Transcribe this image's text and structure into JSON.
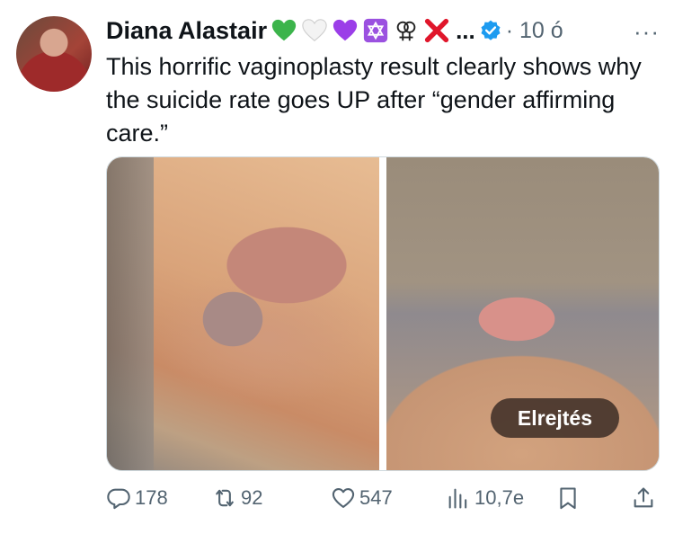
{
  "author": {
    "name": "Diana Alastair",
    "emoji_icons": [
      "green-heart-icon",
      "white-heart-icon",
      "purple-heart-icon",
      "star-of-david-icon",
      "lesbian-symbol-icon",
      "red-x-icon"
    ],
    "ellipsis": "...",
    "verified_color": "#1d9bf0",
    "time": "· 10 ó"
  },
  "more_label": "···",
  "tweet": {
    "text": "This horrific vaginoplasty result clearly shows why the suicide rate goes UP after “gender affirming care.”"
  },
  "media": {
    "hide_button_label": "Elrejtés"
  },
  "actions": {
    "reply_count": "178",
    "retweet_count": "92",
    "like_count": "547",
    "view_count": "10,7e"
  },
  "colors": {
    "text": "#0f1419",
    "secondary": "#536471",
    "accent": "#1d9bf0"
  }
}
